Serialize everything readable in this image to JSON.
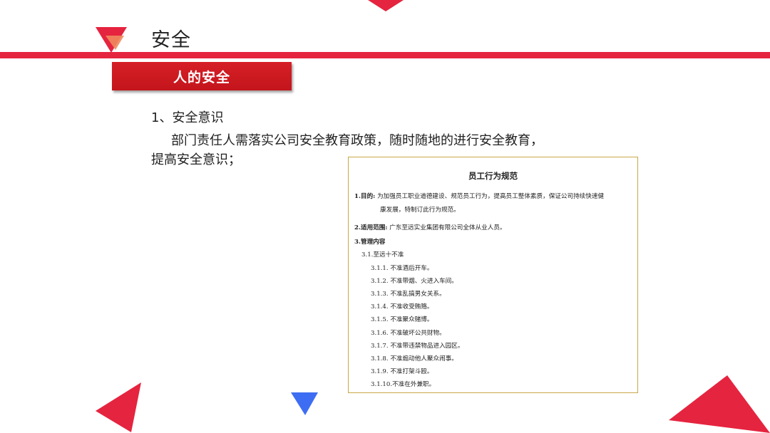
{
  "slide": {
    "title": "安全",
    "banner": "人的安全",
    "heading": "1、安全意识",
    "paragraph_line1": "部门责任人需落实公司安全教育政策，随时随地的进行安全教育，",
    "paragraph_line2": "提高安全意识；"
  },
  "document": {
    "title": "员工行为规范",
    "section1_label": "1.目的:",
    "section1_text_line1": "为加强员工职业道德建设、规范员工行为，提高员工整体素质，保证公司持续快速健",
    "section1_text_line2": "康发展，特制订此行为规范。",
    "section2_label": "2.适用范围:",
    "section2_text": "广东至远实业集团有限公司全体从业人员。",
    "section3_label": "3.管理内容",
    "sub_heading": "3.1.至远十不准",
    "rules": [
      "3.1.1. 不准酒后开车。",
      "3.1.2. 不准带烟、火进入车间。",
      "3.1.3. 不准乱搞男女关系。",
      "3.1.4. 不准收受贿赂。",
      "3.1.5. 不准聚众赌博。",
      "3.1.6. 不准破坏公共财物。",
      "3.1.7. 不准带违禁物品进入园区。",
      "3.1.8. 不准煽动他人聚众闹事。",
      "3.1.9. 不准打架斗殴。",
      "3.1.10.不准在外兼职。"
    ]
  },
  "colors": {
    "accent_red": "#e5243f",
    "banner_red": "#d61f26",
    "accent_orange": "#f08a5d",
    "accent_blue": "#3d6df2",
    "doc_border": "#c9a84a"
  }
}
